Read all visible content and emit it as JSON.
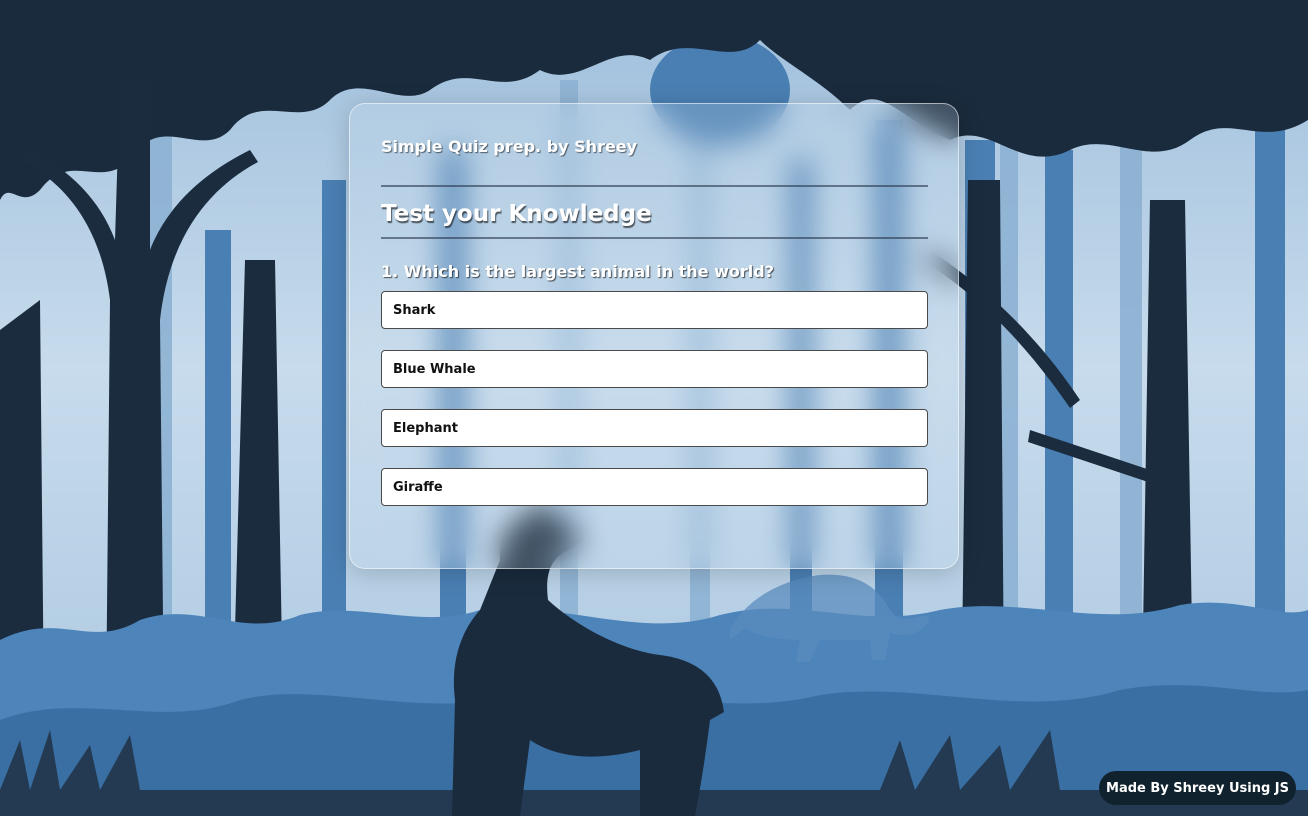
{
  "quiz": {
    "header": "Simple Quiz prep. by Shreey",
    "title": "Test your Knowledge",
    "question": "1. Which is the largest animal in the world?",
    "answers": [
      "Shark",
      "Blue Whale",
      "Elephant",
      "Giraffe"
    ]
  },
  "footer": {
    "credit": "Made By Shreey Using JS"
  },
  "colors": {
    "sky": "#c3d8ea",
    "mid_trees": "#4a7fb3",
    "dark_trees": "#1a2b3d",
    "grass": "#4d84ba",
    "badge": "#10222e"
  }
}
